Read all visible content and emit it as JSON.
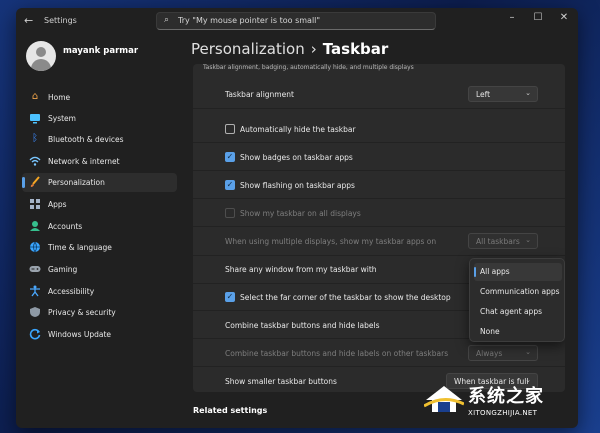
{
  "window": {
    "title": "Settings"
  },
  "search": {
    "placeholder": "Try \"My mouse pointer is too small\""
  },
  "profile": {
    "name": "mayank parmar"
  },
  "nav": {
    "items": [
      {
        "label": "Home",
        "icon": "home-icon",
        "color": "#f0a44a"
      },
      {
        "label": "System",
        "icon": "system-icon",
        "color": "#4cc2ff"
      },
      {
        "label": "Bluetooth & devices",
        "icon": "bluetooth-icon",
        "color": "#3d8bff"
      },
      {
        "label": "Network & internet",
        "icon": "wifi-icon",
        "color": "#7ac6ff"
      },
      {
        "label": "Personalization",
        "icon": "brush-icon",
        "color": "#f5a623"
      },
      {
        "label": "Apps",
        "icon": "apps-icon",
        "color": "#a5b4c8"
      },
      {
        "label": "Accounts",
        "icon": "accounts-icon",
        "color": "#36c08e"
      },
      {
        "label": "Time & language",
        "icon": "globe-icon",
        "color": "#3aa6ff"
      },
      {
        "label": "Gaming",
        "icon": "gaming-icon",
        "color": "#9aa3ad"
      },
      {
        "label": "Accessibility",
        "icon": "accessibility-icon",
        "color": "#4aa8ff"
      },
      {
        "label": "Privacy & security",
        "icon": "shield-icon",
        "color": "#8f9aa6"
      },
      {
        "label": "Windows Update",
        "icon": "update-icon",
        "color": "#3aa6ff"
      }
    ],
    "selected": "Personalization"
  },
  "breadcrumb": {
    "parent": "Personalization",
    "separator": "›",
    "current": "Taskbar"
  },
  "panel": {
    "description": "Taskbar alignment, badging, automatically hide, and multiple displays",
    "alignment": {
      "label": "Taskbar alignment",
      "value": "Left"
    },
    "auto_hide": {
      "label": "Automatically hide the taskbar",
      "checked": false
    },
    "badges": {
      "label": "Show badges on taskbar apps",
      "checked": true
    },
    "flashing": {
      "label": "Show flashing on taskbar apps",
      "checked": true
    },
    "all_displays": {
      "label": "Show my taskbar on all displays",
      "checked": false,
      "disabled": true
    },
    "multi_display": {
      "label": "When using multiple displays, show my taskbar apps on",
      "value": "All taskbars"
    },
    "share_window": {
      "label": "Share any window from my taskbar with"
    },
    "far_corner": {
      "label": "Select the far corner of the taskbar to show the desktop",
      "checked": true
    },
    "combine": {
      "label": "Combine taskbar buttons and hide labels"
    },
    "combine_other": {
      "label": "Combine taskbar buttons and hide labels on other taskbars",
      "value": "Always"
    },
    "smaller_buttons": {
      "label": "Show smaller taskbar buttons",
      "value": "When taskbar is full"
    }
  },
  "share_flyout": {
    "options": [
      "All apps",
      "Communication apps",
      "Chat agent apps",
      "None"
    ],
    "selected": "All apps"
  },
  "related": {
    "title": "Related settings"
  },
  "watermark": {
    "text": "系统之家",
    "url": "XITONGZHIJIA.NET"
  },
  "colors": {
    "accent": "#5aa0e8",
    "window_bg": "#202020",
    "panel_bg": "#2b2b2b"
  }
}
